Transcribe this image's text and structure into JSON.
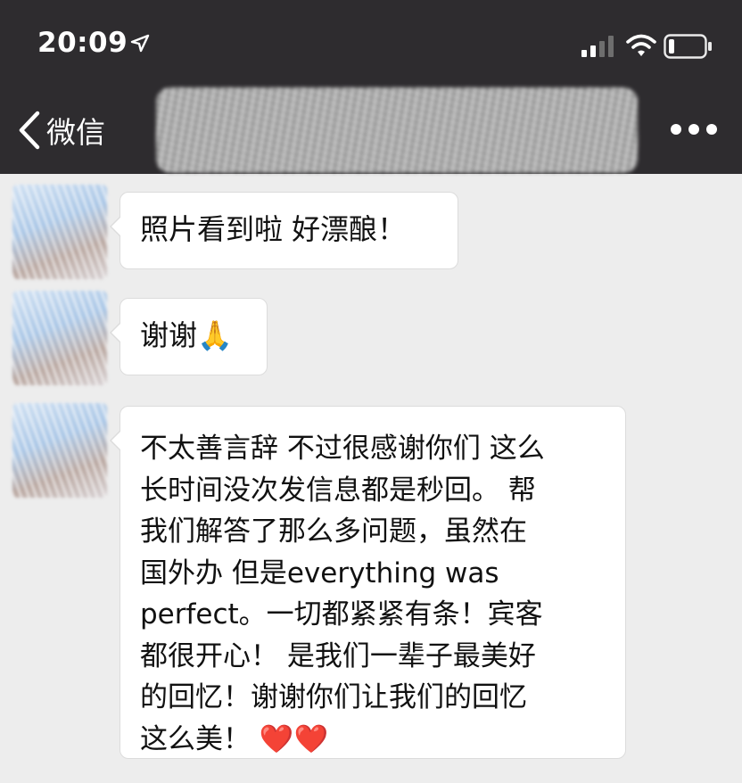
{
  "status_bar": {
    "time": "20:09",
    "icons": [
      "location-arrow-icon",
      "signal-icon",
      "wifi-icon",
      "battery-icon"
    ]
  },
  "nav": {
    "back_label": "微信",
    "back_icon": "chevron-left-icon",
    "more_icon": "more-dots-icon"
  },
  "messages": [
    {
      "text": "照片看到啦 好漂酿！"
    },
    {
      "text": "谢谢🙏"
    },
    {
      "text": "不太善言辞 不过很感谢你们 这么\n长时间没次发信息都是秒回。 帮\n我们解答了那么多问题，虽然在\n国外办 但是everything was\nperfect。一切都紧紧有条！宾客\n都很开心！ 是我们一辈子最美好\n的回忆！谢谢你们让我们的回忆\n这么美！ ❤️❤️"
    }
  ],
  "colors": {
    "header_bg": "#2e2c2f",
    "chat_bg": "#ededed",
    "bubble_bg": "#ffffff"
  }
}
